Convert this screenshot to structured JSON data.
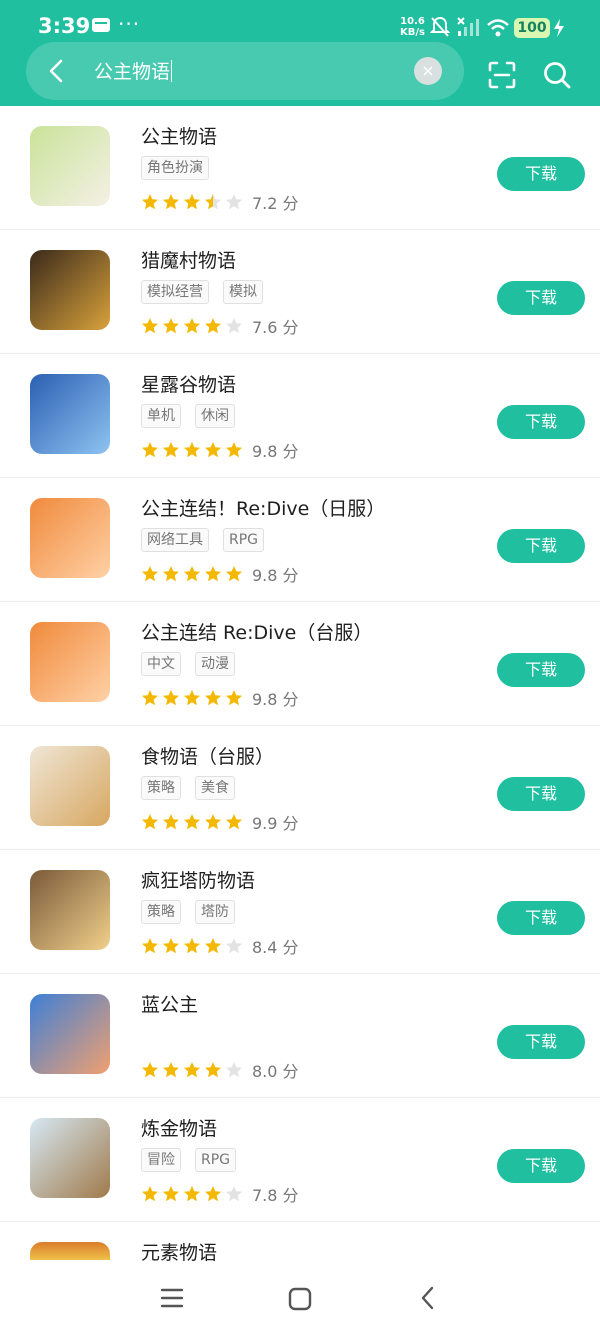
{
  "status": {
    "time": "3:39",
    "dots": "···",
    "net_speed": "10.6",
    "net_unit": "KB/s",
    "battery": "100"
  },
  "search": {
    "query": "公主物语",
    "clear_glyph": "×"
  },
  "apps": [
    {
      "name": "公主物语",
      "tags": [
        "角色扮演"
      ],
      "stars": 3.5,
      "score": "7.2 分",
      "button": "下载",
      "icon_colors": [
        "#c9e39a",
        "#f4f0e4"
      ]
    },
    {
      "name": "猎魔村物语",
      "tags": [
        "模拟经营",
        "模拟"
      ],
      "stars": 4,
      "score": "7.6 分",
      "button": "下载",
      "icon_colors": [
        "#3a2a1a",
        "#d9a23c"
      ]
    },
    {
      "name": "星露谷物语",
      "tags": [
        "单机",
        "休闲"
      ],
      "stars": 5,
      "score": "9.8 分",
      "button": "下载",
      "icon_colors": [
        "#2b5fb3",
        "#8ec3f0"
      ]
    },
    {
      "name": "公主连结！Re:Dive（日服）",
      "tags": [
        "网络工具",
        "RPG"
      ],
      "stars": 5,
      "score": "9.8 分",
      "button": "下载",
      "icon_colors": [
        "#f08a3c",
        "#ffd1a6"
      ]
    },
    {
      "name": "公主连结 Re:Dive（台服）",
      "tags": [
        "中文",
        "动漫"
      ],
      "stars": 5,
      "score": "9.8 分",
      "button": "下载",
      "icon_colors": [
        "#f08a3c",
        "#ffd1a6"
      ]
    },
    {
      "name": "食物语（台服）",
      "tags": [
        "策略",
        "美食"
      ],
      "stars": 5,
      "score": "9.9 分",
      "button": "下载",
      "icon_colors": [
        "#efe6d6",
        "#d7a760"
      ]
    },
    {
      "name": "疯狂塔防物语",
      "tags": [
        "策略",
        "塔防"
      ],
      "stars": 4,
      "score": "8.4 分",
      "button": "下载",
      "icon_colors": [
        "#7a5a3a",
        "#f1d08a"
      ]
    },
    {
      "name": "蓝公主",
      "tags": [],
      "stars": 4,
      "score": "8.0 分",
      "button": "下载",
      "icon_colors": [
        "#3e7fd6",
        "#f0a070"
      ]
    },
    {
      "name": "炼金物语",
      "tags": [
        "冒险",
        "RPG"
      ],
      "stars": 4,
      "score": "7.8 分",
      "button": "下载",
      "icon_colors": [
        "#d6e8f4",
        "#a07a4a"
      ]
    }
  ],
  "partial_app": {
    "name": "元素物语"
  },
  "colors": {
    "accent": "#1fbf9f",
    "star_on": "#f5b800",
    "star_off": "#e3e3e3"
  },
  "icons": {
    "back": "back-icon",
    "clear": "clear-icon",
    "scan": "scan-icon",
    "search": "search-icon",
    "nav_menu": "menu-icon",
    "nav_home": "home-icon",
    "nav_back": "back-icon"
  }
}
